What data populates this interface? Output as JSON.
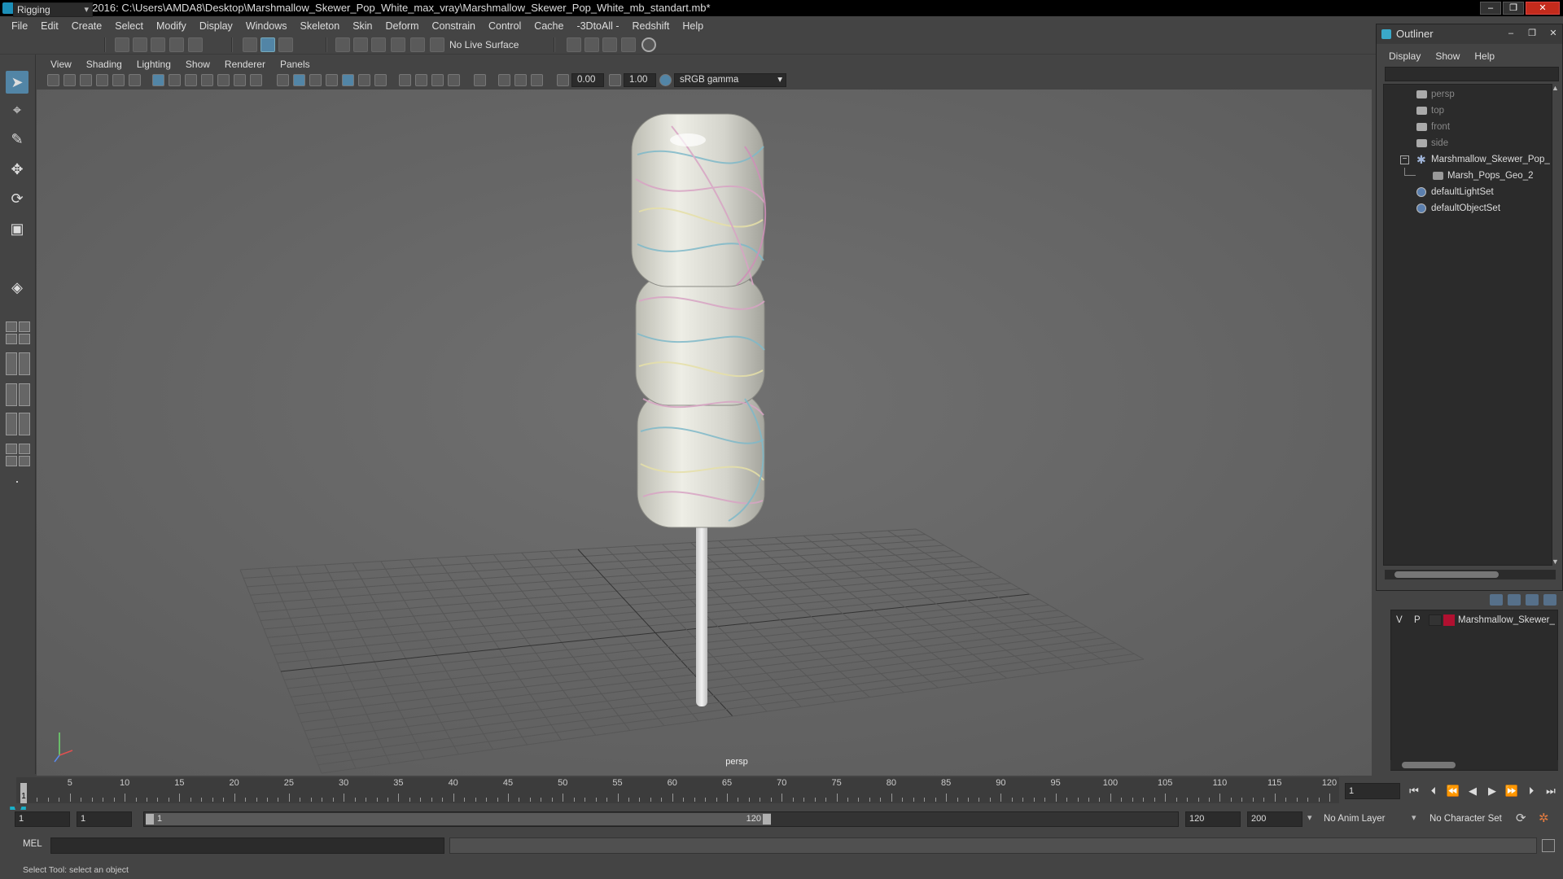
{
  "window": {
    "title": "Autodesk Maya 2016: C:\\Users\\AMDA8\\Desktop\\Marshmallow_Skewer_Pop_White_max_vray\\Marshmallow_Skewer_Pop_White_mb_standart.mb*"
  },
  "menubar": [
    "File",
    "Edit",
    "Create",
    "Select",
    "Modify",
    "Display",
    "Windows",
    "Skeleton",
    "Skin",
    "Deform",
    "Constrain",
    "Control",
    "Cache",
    "-3DtoAll -",
    "Redshift",
    "Help"
  ],
  "statusline": {
    "menu_set": "Rigging",
    "live_surface": "No Live Surface"
  },
  "viewport": {
    "menu": [
      "View",
      "Shading",
      "Lighting",
      "Show",
      "Renderer",
      "Panels"
    ],
    "exposure": "0.00",
    "gamma": "1.00",
    "color_space": "sRGB gamma",
    "camera_label": "persp"
  },
  "outliner": {
    "title": "Outliner",
    "menu": [
      "Display",
      "Show",
      "Help"
    ],
    "items": [
      {
        "label": "persp",
        "type": "camera",
        "dim": true
      },
      {
        "label": "top",
        "type": "camera",
        "dim": true
      },
      {
        "label": "front",
        "type": "camera",
        "dim": true
      },
      {
        "label": "side",
        "type": "camera",
        "dim": true
      },
      {
        "label": "Marshmallow_Skewer_Pop_",
        "type": "group",
        "dim": false
      },
      {
        "label": "Marsh_Pops_Geo_2",
        "type": "mesh",
        "dim": false
      },
      {
        "label": "defaultLightSet",
        "type": "set",
        "dim": false
      },
      {
        "label": "defaultObjectSet",
        "type": "set",
        "dim": false
      }
    ]
  },
  "layers": {
    "visible": "V",
    "playback": "P",
    "layer_name": "Marshmallow_Skewer_",
    "layer_color": "#b01030"
  },
  "timeslider": {
    "ticks": [
      5,
      10,
      15,
      20,
      25,
      30,
      35,
      40,
      45,
      50,
      55,
      60,
      65,
      70,
      75,
      80,
      85,
      90,
      95,
      100,
      105,
      110,
      115,
      120
    ],
    "current_frame": "1",
    "current_frame_field": "1"
  },
  "range": {
    "start_time": "1",
    "playback_start": "1",
    "range_start": "1",
    "range_end": "120",
    "playback_end": "120",
    "end_time": "200",
    "anim_layer": "No Anim Layer",
    "character_set": "No Character Set"
  },
  "command": {
    "language": "MEL"
  },
  "helpline": "Select Tool: select an object",
  "colors": {
    "accent": "#5285a6",
    "viewport_bg": "#6a6a6a",
    "panel_bg": "#444444"
  }
}
